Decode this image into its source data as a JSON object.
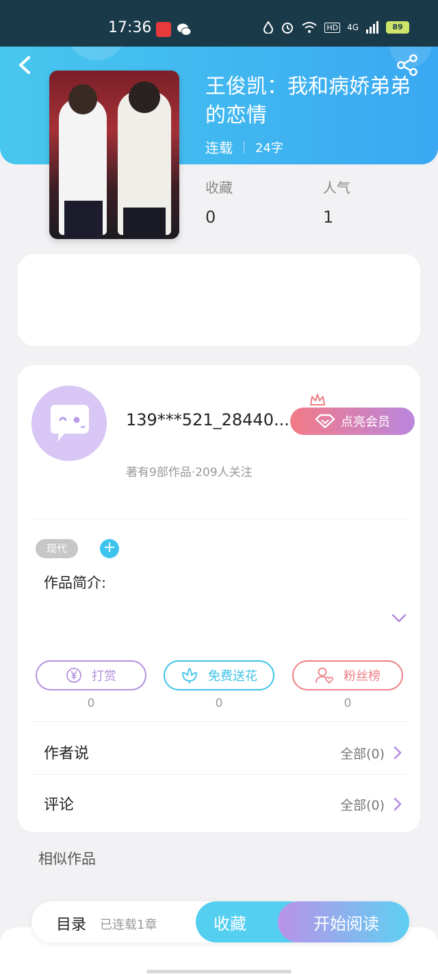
{
  "status_bar": {
    "time": "17:36",
    "network": "4G",
    "battery": "89",
    "hd_label": "HD",
    "app_icons": [
      "app-notification-icon",
      "wechat-icon"
    ],
    "sys_icons": [
      "water-drop-icon",
      "alarm-icon",
      "wifi-icon",
      "signal-icon"
    ]
  },
  "header": {
    "back_icon": "chevron-left-icon",
    "share_icon": "share-icon",
    "book_title": "王俊凯：我和病娇弟弟的恋情",
    "serial_status": "连载",
    "word_count": "24字",
    "stats": [
      {
        "label": "收藏",
        "value": "0"
      },
      {
        "label": "人气",
        "value": "1"
      }
    ]
  },
  "author": {
    "name": "139***521_28440...",
    "meta": "著有9部作品·209人关注",
    "vip_button": "点亮会员"
  },
  "book": {
    "tag": "现代",
    "add_tag": "+",
    "intro_label": "作品简介:"
  },
  "actions": [
    {
      "label": "打赏",
      "count": "0",
      "icon": "yen-coin-icon",
      "color": "#b38fdd"
    },
    {
      "label": "免费送花",
      "count": "0",
      "icon": "flower-icon",
      "color": "#3dc4e8"
    },
    {
      "label": "粉丝榜",
      "count": "0",
      "icon": "user-heart-icon",
      "color": "#ee7f86"
    }
  ],
  "rows": [
    {
      "label": "作者说",
      "right": "全部(0)"
    },
    {
      "label": "评论",
      "right": "全部(0)"
    }
  ],
  "similar_label": "相似作品",
  "bottom_bar": {
    "toc": "目录",
    "chapters": "已连载1章",
    "favorite": "收藏",
    "start_reading": "开始阅读"
  },
  "colors": {
    "header_start": "#48c7ee",
    "header_end": "#3aa8f2",
    "accent_purple": "#b58be0",
    "accent_cyan": "#3dc4ee",
    "accent_pink": "#ee7f86"
  }
}
